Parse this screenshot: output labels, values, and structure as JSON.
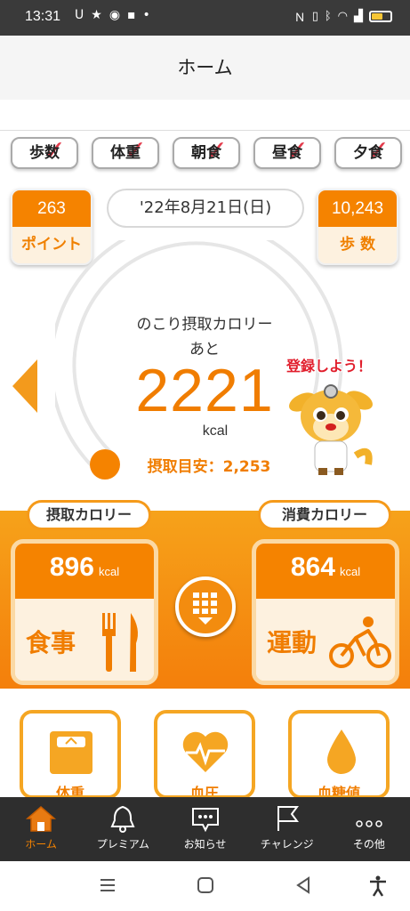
{
  "status_bar": {
    "time": "13:31",
    "left_icons": [
      "notification-u-icon",
      "star-icon",
      "sync-icon",
      "message-icon",
      "dot-icon"
    ],
    "right_icons": [
      "nfc-icon",
      "vibrate-icon",
      "bluetooth-icon",
      "wifi-icon",
      "signal-icon",
      "battery-icon"
    ],
    "battery_level": 0.5
  },
  "header": {
    "title": "ホーム"
  },
  "stamps": [
    {
      "label": "歩数",
      "checked": true
    },
    {
      "label": "体重",
      "checked": true
    },
    {
      "label": "朝食",
      "checked": true
    },
    {
      "label": "昼食",
      "checked": true
    },
    {
      "label": "夕食",
      "checked": true
    }
  ],
  "points": {
    "value": "263",
    "label": "ポイント"
  },
  "steps": {
    "value": "10,243",
    "label": "歩 数"
  },
  "date": "'22年8月21日(日)",
  "gauge": {
    "label": "のこり摂取カロリー",
    "ato": "あと",
    "value": "2221",
    "unit": "kcal",
    "target": "摂取目安：2,253",
    "fill_fraction": 0.02
  },
  "mascot": {
    "bubble": "登録しよう！"
  },
  "intake": {
    "tag": "摂取カロリー",
    "value": "896",
    "unit": "kcal",
    "label": "食事"
  },
  "burn": {
    "tag": "消費カロリー",
    "value": "864",
    "unit": "kcal",
    "label": "運動"
  },
  "metrics": [
    {
      "label": "体重",
      "icon": "scale-icon"
    },
    {
      "label": "血圧",
      "icon": "heart-pulse-icon"
    },
    {
      "label": "血糖値",
      "icon": "drop-icon"
    }
  ],
  "tabs": [
    {
      "label": "ホーム",
      "icon": "home-icon",
      "active": true
    },
    {
      "label": "プレミアム",
      "icon": "bell-icon",
      "active": false
    },
    {
      "label": "お知らせ",
      "icon": "chat-icon",
      "active": false
    },
    {
      "label": "チャレンジ",
      "icon": "flag-icon",
      "active": false
    },
    {
      "label": "その他",
      "icon": "more-icon",
      "active": false
    }
  ],
  "colors": {
    "accent": "#f58300",
    "accent_light": "#fdf1df",
    "tab_bg": "#2e2e2e",
    "check": "#e33b4c"
  }
}
